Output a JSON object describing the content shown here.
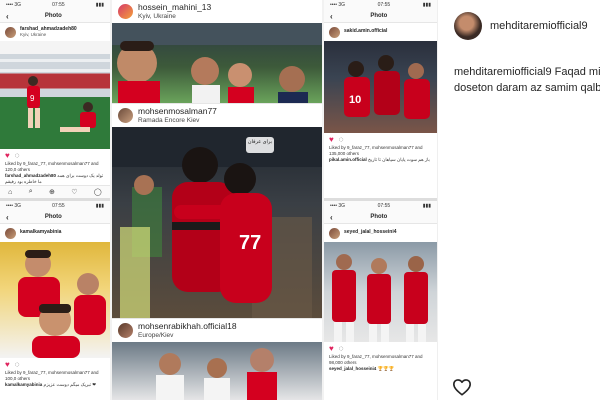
{
  "collage": {
    "col1": {
      "screen1": {
        "status_left": "•••• 3G",
        "status_time": "07:55",
        "status_right": "▮▮▮",
        "nav_title": "Photo",
        "user": "farshad_ahmadzadeh80",
        "location": "Kyiv, Ukraine",
        "liked_by": "Liked by 9_faraz_77, mohsenmosalman77 and 120,0 others",
        "comment_user": "farshad_ahmadzadeh80",
        "comment_text": "تولد یک دوست برای همه ما خاطره بود رفیقم",
        "tabbar_icons": [
          "⌂",
          "⌕",
          "⊕",
          "♡",
          "◯"
        ]
      },
      "screen2": {
        "status_left": "•••• 3G",
        "status_time": "07:55",
        "status_right": "▮▮▮",
        "nav_title": "Photo",
        "user": "kamalkamyabinia",
        "liked_by": "Liked by 9_faraz_77, mohsenmosalman77 and 100,0 others",
        "comment_user": "kamalkamyabinia",
        "comment_text": "تبریک میگم دوست عزیزم ❤"
      }
    },
    "col2": {
      "post1": {
        "user": "hossein_mahini_13",
        "location": "Kyiv, Ukraine"
      },
      "post2": {
        "user": "mohsenmosalman77",
        "location": "Ramada Encore Kiev",
        "watermark": "برای عرفان"
      },
      "post3": {
        "user": "mohsenrabikhah.official18",
        "location": "Europe/Kiev"
      }
    },
    "col3": {
      "screen1": {
        "status_left": "•••• 3G",
        "status_time": "07:55",
        "status_right": "▮▮▮",
        "nav_title": "Photo",
        "user": "sakid.amin.official",
        "liked_by": "Liked by 9_faraz_77, mohsenmosalman77 and 135,000 others",
        "comment_user": "pikal.amin.official",
        "comment_text": "باز هم سوت پایان سپاهان تا تاریخ"
      },
      "screen2": {
        "status_left": "•••• 3G",
        "status_time": "07:55",
        "status_right": "▮▮▮",
        "nav_title": "Photo",
        "user": "seyed_jalal_hosseini4",
        "liked_by": "Liked by 9_faraz_77, mohsenmosalman77 and 98,000 others",
        "comment_user": "seyed_jalal_hosseini4",
        "comment_text": "🏆🏆🏆"
      }
    }
  },
  "post": {
    "username": "mehditaremiofficial9",
    "caption_line1": "mehditaremiofficial9 Faqad mit",
    "caption_line2": "doseton daram az samim qalb ❤"
  },
  "icons": {
    "heart_filled": "heart-icon",
    "comment": "comment-icon",
    "share": "share-icon",
    "like_button": "heart-outline-icon"
  },
  "colors": {
    "brand_red": "#d4001f",
    "heart_red": "#e0245e",
    "text": "#262626"
  }
}
